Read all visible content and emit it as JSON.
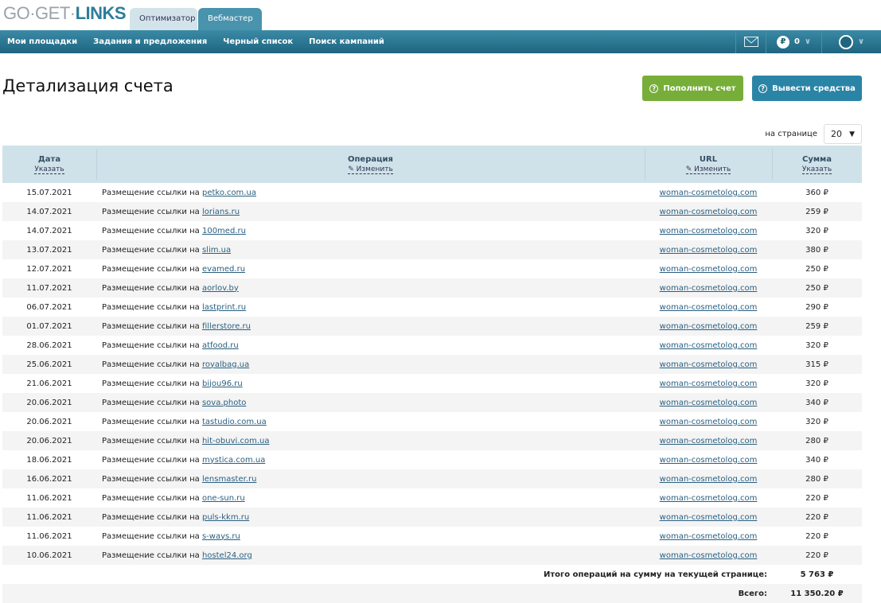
{
  "logo": {
    "a": "GO·GET·",
    "b": "LINKS"
  },
  "tabs": [
    "Оптимизатор",
    "Вебмастер"
  ],
  "nav": [
    "Мои площадки",
    "Задания и предложения",
    "Черный список",
    "Поиск кампаний"
  ],
  "balance": "0",
  "title": "Детализация счета",
  "buttons": {
    "topup": "Пополнить счет",
    "withdraw": "Вывести средства"
  },
  "per_page": {
    "label": "на странице",
    "value": "20"
  },
  "columns": [
    {
      "title": "Дата",
      "action": "Указать"
    },
    {
      "title": "Операция",
      "action": "Изменить"
    },
    {
      "title": "URL",
      "action": "Изменить"
    },
    {
      "title": "Сумма",
      "action": "Указать"
    }
  ],
  "op_prefix": "Размещение ссылки на",
  "rows": [
    [
      "15.07.2021",
      "petko.com.ua",
      "woman-cosmetolog.com",
      "360 ₽"
    ],
    [
      "14.07.2021",
      "lorians.ru",
      "woman-cosmetolog.com",
      "259 ₽"
    ],
    [
      "14.07.2021",
      "100med.ru",
      "woman-cosmetolog.com",
      "320 ₽"
    ],
    [
      "13.07.2021",
      "slim.ua",
      "woman-cosmetolog.com",
      "380 ₽"
    ],
    [
      "12.07.2021",
      "evamed.ru",
      "woman-cosmetolog.com",
      "250 ₽"
    ],
    [
      "11.07.2021",
      "aorlov.by",
      "woman-cosmetolog.com",
      "250 ₽"
    ],
    [
      "06.07.2021",
      "lastprint.ru",
      "woman-cosmetolog.com",
      "290 ₽"
    ],
    [
      "01.07.2021",
      "fillerstore.ru",
      "woman-cosmetolog.com",
      "259 ₽"
    ],
    [
      "28.06.2021",
      "atfood.ru",
      "woman-cosmetolog.com",
      "320 ₽"
    ],
    [
      "25.06.2021",
      "royalbag.ua",
      "woman-cosmetolog.com",
      "315 ₽"
    ],
    [
      "21.06.2021",
      "bijou96.ru",
      "woman-cosmetolog.com",
      "320 ₽"
    ],
    [
      "20.06.2021",
      "sova.photo",
      "woman-cosmetolog.com",
      "340 ₽"
    ],
    [
      "20.06.2021",
      "tastudio.com.ua",
      "woman-cosmetolog.com",
      "320 ₽"
    ],
    [
      "20.06.2021",
      "hit-obuvi.com.ua",
      "woman-cosmetolog.com",
      "280 ₽"
    ],
    [
      "18.06.2021",
      "mystica.com.ua",
      "woman-cosmetolog.com",
      "340 ₽"
    ],
    [
      "16.06.2021",
      "lensmaster.ru",
      "woman-cosmetolog.com",
      "280 ₽"
    ],
    [
      "11.06.2021",
      "one-sun.ru",
      "woman-cosmetolog.com",
      "220 ₽"
    ],
    [
      "11.06.2021",
      "puls-kkm.ru",
      "woman-cosmetolog.com",
      "220 ₽"
    ],
    [
      "11.06.2021",
      "s-ways.ru",
      "woman-cosmetolog.com",
      "220 ₽"
    ],
    [
      "10.06.2021",
      "hostel24.org",
      "woman-cosmetolog.com",
      "220 ₽"
    ]
  ],
  "totals": {
    "page_label": "Итого операций на сумму на текущей странице:",
    "page_value": "5 763 ₽",
    "all_label": "Всего:",
    "all_value": "11 350.20 ₽"
  }
}
